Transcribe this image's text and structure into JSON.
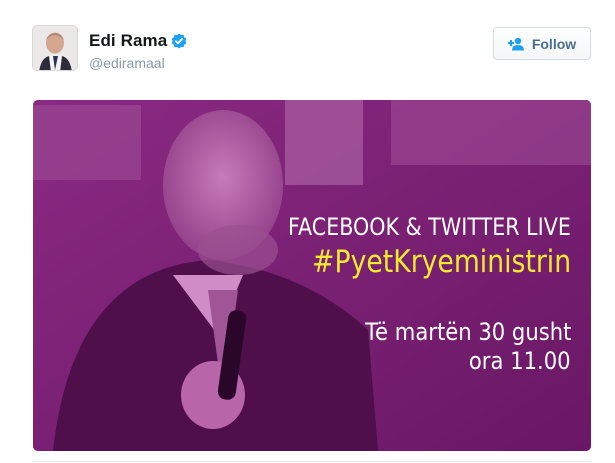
{
  "author": {
    "display_name": "Edi Rama",
    "handle": "@ediramaal",
    "verified": true,
    "avatar_icon": "profile-photo"
  },
  "follow_button": {
    "label": "Follow",
    "icon": "add-user-icon"
  },
  "media": {
    "line1": "FACEBOOK & TWITTER LIVE",
    "hashtag": "#PyetKryeministrin",
    "line3": "Të martën 30 gusht",
    "line4": "ora 11.00"
  },
  "colors": {
    "accent_blue": "#1da1f2",
    "hashtag_yellow": "#f1ea2f",
    "media_purple": "#7b1b74"
  }
}
